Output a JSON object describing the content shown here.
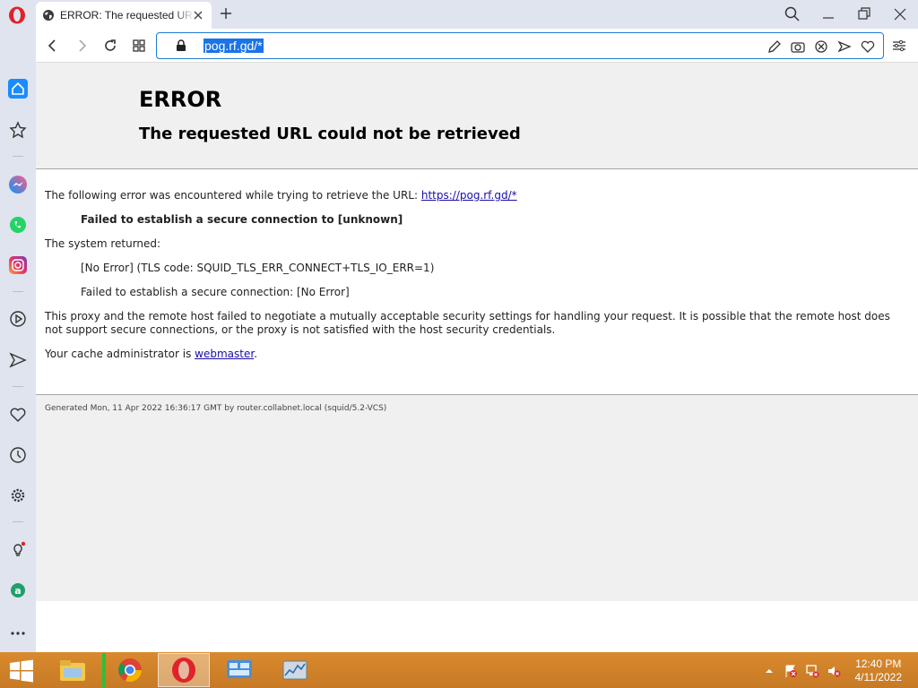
{
  "browser": {
    "tab_title": "ERROR: The requested URL could not be retrieved",
    "url": "pog.rf.gd/*"
  },
  "page": {
    "error_title": "ERROR",
    "error_subtitle": "The requested URL could not be retrieved",
    "line1_prefix": "The following error was encountered while trying to retrieve the URL: ",
    "line1_link": "https://pog.rf.gd/*",
    "failed_secure": "Failed to establish a secure connection to [unknown]",
    "system_returned": "The system returned:",
    "no_error_line": "[No Error] (TLS code: SQUID_TLS_ERR_CONNECT+TLS_IO_ERR=1)",
    "failed_secure_2": "Failed to establish a secure connection: [No Error]",
    "explanation": "This proxy and the remote host failed to negotiate a mutually acceptable security settings for handling your request. It is possible that the remote host does not support secure connections, or the proxy is not satisfied with the host security credentials.",
    "admin_prefix": "Your cache administrator is ",
    "admin_link": "webmaster",
    "admin_suffix": ".",
    "generated": "Generated Mon, 11 Apr 2022 16:36:17 GMT by router.collabnet.local (squid/5.2-VCS)"
  },
  "taskbar": {
    "time": "12:40 PM",
    "date": "4/11/2022"
  },
  "colors": {
    "accent": "#1a73e8",
    "opera_red": "#e0222a",
    "taskbar": "#d98a2e"
  },
  "icons": {
    "sidebar": [
      "home-icon",
      "speed-dial-icon",
      "messenger-icon",
      "whatsapp-icon",
      "instagram-icon",
      "player-icon",
      "send-icon",
      "heart-icon",
      "history-icon",
      "settings-icon",
      "tips-icon",
      "aria-icon",
      "more-icon"
    ]
  }
}
